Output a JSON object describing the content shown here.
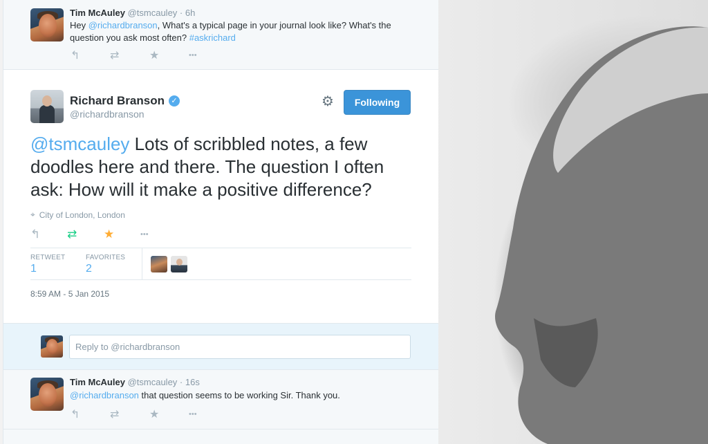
{
  "tweet_top": {
    "name": "Tim McAuley",
    "handle": "@tsmcauley",
    "time": "· 6h",
    "text_prefix": "Hey ",
    "mention": "@richardbranson",
    "text_body": ", What's a typical page in your journal look like? What's the question you ask most often? ",
    "hashtag": "#askrichard"
  },
  "main_tweet": {
    "name": "Richard Branson",
    "handle": "@richardbranson",
    "follow_label": "Following",
    "mention": "@tsmcauley",
    "text": " Lots of scribbled notes, a few doodles here and there. The question I often ask: How will it make a positive difference?",
    "location": "City of London, London",
    "retweet_label": "RETWEET",
    "retweet_count": "1",
    "favorites_label": "FAVORITES",
    "favorites_count": "2",
    "timestamp": "8:59 AM - 5 Jan 2015"
  },
  "reply": {
    "placeholder": "Reply to @richardbranson"
  },
  "tweet_bottom": {
    "name": "Tim McAuley",
    "handle": "@tsmcauley",
    "time": "· 16s",
    "mention": "@richardbranson",
    "text": " that question seems to be working Sir. Thank you."
  },
  "icons": {
    "reply": "↰",
    "retweet": "⇄",
    "favorite": "★",
    "more": "•••",
    "gear": "⚙",
    "pin": "⌖",
    "check": "✓",
    "bird": "♥"
  },
  "colors": {
    "link": "#55acee",
    "follow_button": "#3b94d9",
    "retweet_active": "#19cf86",
    "favorite_active": "#ffac33"
  }
}
